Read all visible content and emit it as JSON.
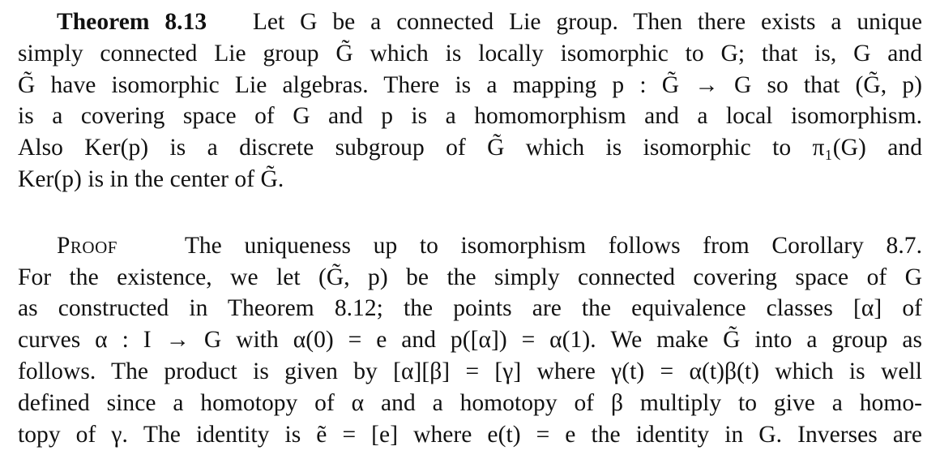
{
  "theorem": {
    "label": "Theorem 8.13",
    "lines": [
      "Let G be a connected Lie group. Then there exists a unique",
      "simply connected Lie group G̃ which is locally isomorphic to G; that is, G and",
      "G̃ have isomorphic Lie algebras. There is a mapping p : G̃ → G so that (G̃, p)",
      "is a covering space of G and p is a homomorphism and a local isomorphism.",
      "Also Ker(p) is a discrete subgroup of G̃ which is isomorphic to π₁(G) and",
      "Ker(p) is in the center of G̃."
    ]
  },
  "proof": {
    "label": "Proof",
    "lines": [
      "The uniqueness up to isomorphism follows from Corollary 8.7.",
      "For the existence, we let (G̃, p) be the simply connected covering space of G",
      "as constructed in Theorem 8.12; the points are the equivalence classes [α] of",
      "curves α : I → G with α(0) = e and p([α]) = α(1). We make G̃ into a group as",
      "follows. The product is given by [α][β] = [γ] where γ(t) = α(t)β(t) which is well",
      "defined since a homotopy of α and a homotopy of β multiply to give a homo-",
      "topy of γ. The identity is ẽ = [e] where e(t) = e the identity in G. Inverses are"
    ]
  }
}
